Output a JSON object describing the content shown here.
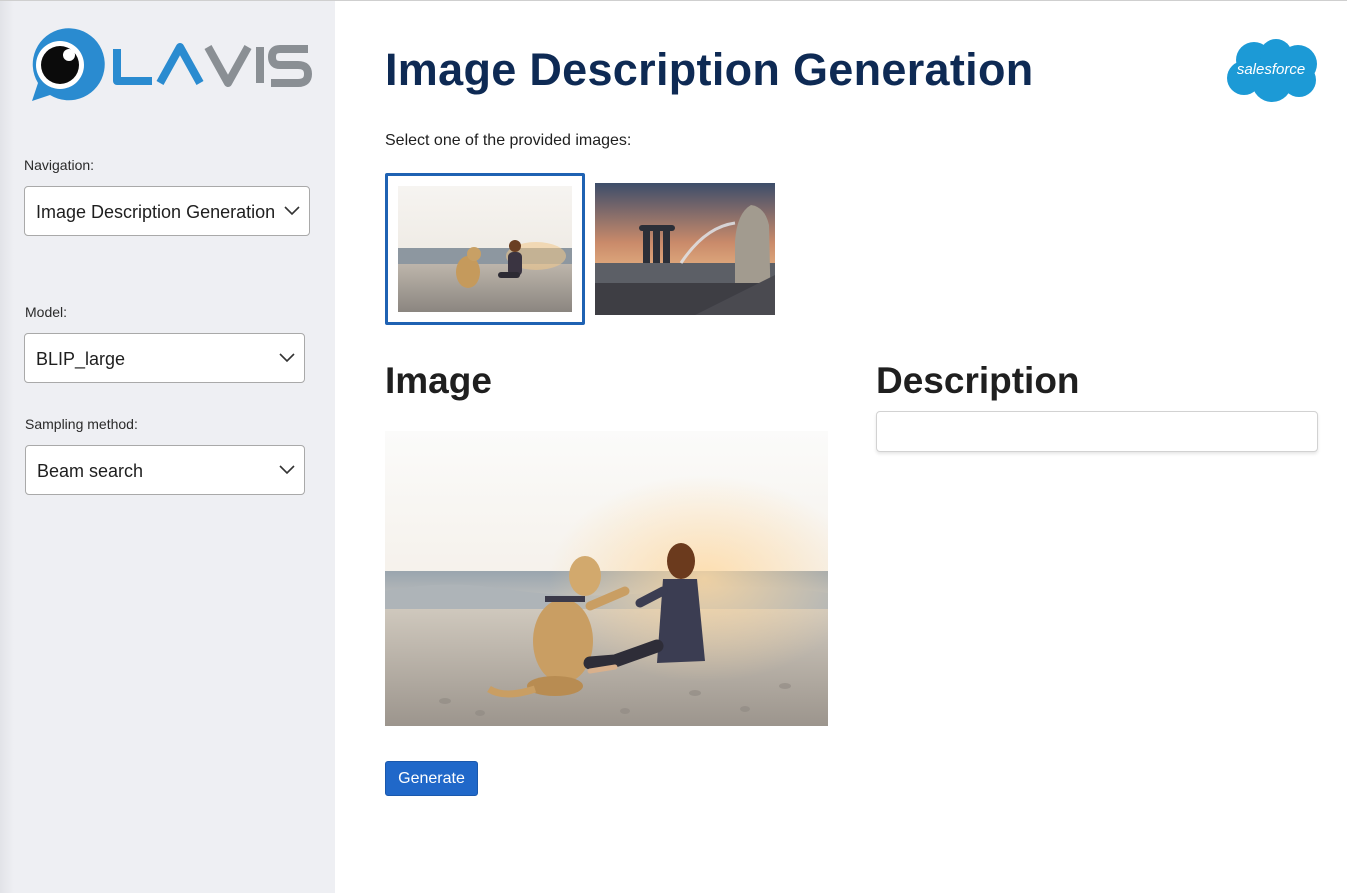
{
  "sidebar": {
    "logo_text": "LAVIS",
    "navigation": {
      "label": "Navigation:",
      "value": "Image Description Generation"
    },
    "model": {
      "label": "Model:",
      "value": "BLIP_large"
    },
    "sampling": {
      "label": "Sampling method:",
      "value": "Beam search"
    }
  },
  "main": {
    "title": "Image Description Generation",
    "brand_logo_text": "salesforce",
    "select_prompt": "Select one of the provided images:",
    "thumbnails": [
      "beach-dog-thumbnail",
      "singapore-merlion-thumbnail"
    ],
    "image_heading": "Image",
    "description_heading": "Description",
    "description_value": "",
    "generate_label": "Generate"
  },
  "colors": {
    "title": "#0e2a54",
    "accent": "#1f62b3",
    "button": "#2068c9",
    "sidebar_bg": "#eeeff3",
    "logo_blue": "#2a8bd0",
    "salesforce_blue": "#1c9ad6"
  },
  "icons": [
    "chevron-down-icon",
    "lavis-eye-icon",
    "salesforce-cloud-icon"
  ]
}
